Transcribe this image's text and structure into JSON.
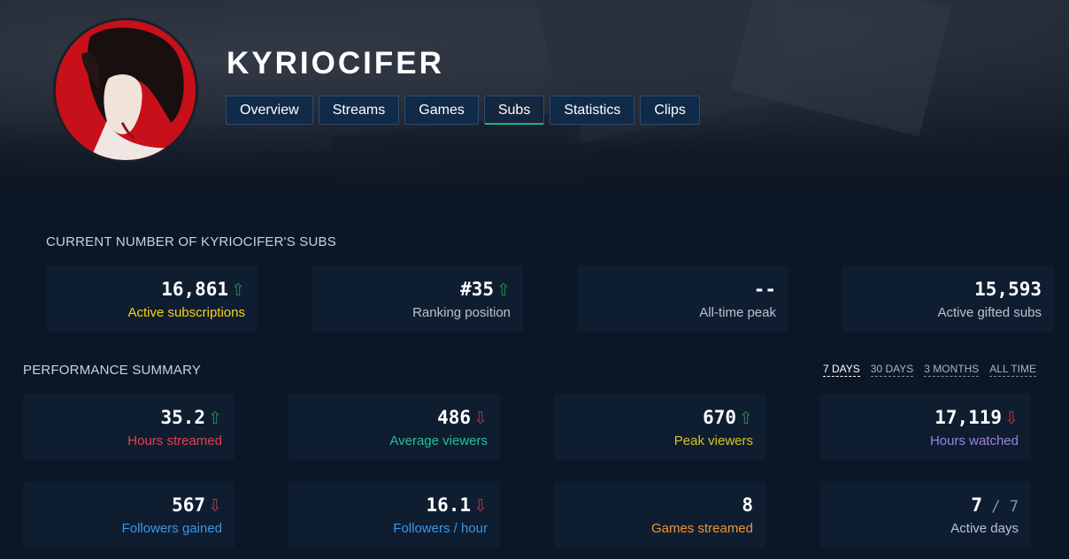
{
  "channel": {
    "name": "KYRIOCIFER"
  },
  "tabs": [
    "Overview",
    "Streams",
    "Games",
    "Subs",
    "Statistics",
    "Clips"
  ],
  "active_tab": "Subs",
  "subs": {
    "title": "CURRENT NUMBER OF KYRIOCIFER'S SUBS",
    "cards": [
      {
        "value": "16,861",
        "trend": "up",
        "label": "Active subscriptions",
        "label_color": "#f5d31c"
      },
      {
        "value": "#35",
        "trend": "up",
        "label": "Ranking position",
        "label_color": "#b9c2ce"
      },
      {
        "value": "--",
        "trend": "",
        "label": "All-time peak",
        "label_color": "#b9c2ce"
      },
      {
        "value": "15,593",
        "trend": "",
        "label": "Active gifted subs",
        "label_color": "#b9c2ce"
      }
    ]
  },
  "performance": {
    "title": "PERFORMANCE SUMMARY",
    "ranges": [
      "7 DAYS",
      "30 DAYS",
      "3 MONTHS",
      "ALL TIME"
    ],
    "selected_range": "7 DAYS",
    "cards": [
      {
        "value": "35.2",
        "trend": "up",
        "label": "Hours streamed",
        "label_color": "#e5414d"
      },
      {
        "value": "486",
        "trend": "down",
        "label": "Average viewers",
        "label_color": "#26c09a"
      },
      {
        "value": "670",
        "trend": "up",
        "label": "Peak viewers",
        "label_color": "#d7c42a"
      },
      {
        "value": "17,119",
        "trend": "down",
        "label": "Hours watched",
        "label_color": "#9a82de"
      },
      {
        "value": "567",
        "trend": "down",
        "label": "Followers gained",
        "label_color": "#3d97e6"
      },
      {
        "value": "16.1",
        "trend": "down",
        "label": "Followers / hour",
        "label_color": "#3d97e6"
      },
      {
        "value": "8",
        "trend": "",
        "label": "Games streamed",
        "label_color": "#f0962e"
      },
      {
        "value": "7",
        "suffix": "7",
        "trend": "",
        "label": "Active days",
        "label_color": "#b9c2ce"
      }
    ]
  },
  "icons": {
    "up": "arrow-up-icon",
    "down": "arrow-down-icon"
  }
}
